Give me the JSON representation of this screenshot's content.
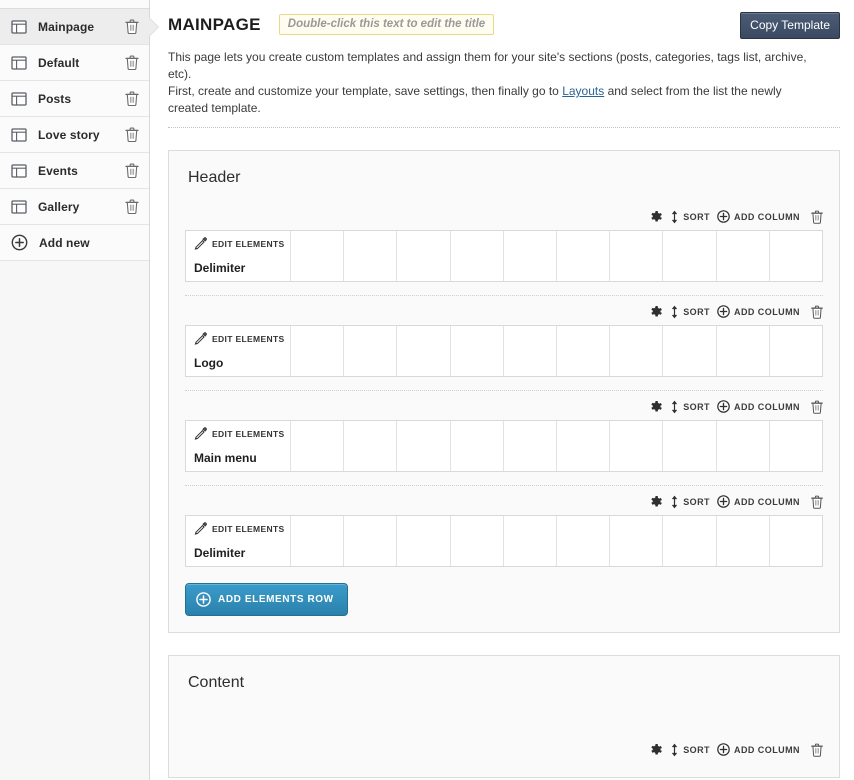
{
  "sidebar": {
    "items": [
      {
        "label": "Mainpage",
        "icon": "template-icon",
        "active": true,
        "delete_icon": "trash-icon"
      },
      {
        "label": "Default",
        "icon": "template-icon",
        "active": false,
        "delete_icon": "trash-icon"
      },
      {
        "label": "Posts",
        "icon": "template-icon",
        "active": false,
        "delete_icon": "trash-icon"
      },
      {
        "label": "Love story",
        "icon": "template-icon",
        "active": false,
        "delete_icon": "trash-icon"
      },
      {
        "label": "Events",
        "icon": "template-icon",
        "active": false,
        "delete_icon": "trash-icon"
      },
      {
        "label": "Gallery",
        "icon": "template-icon",
        "active": false,
        "delete_icon": "trash-icon"
      }
    ],
    "add_new": {
      "label": "Add new",
      "icon": "plus-circle-icon"
    }
  },
  "header": {
    "title": "MAINPAGE",
    "title_hint": "Double-click this text to edit the title",
    "copy_template_label": "Copy Template",
    "intro_line1": "This page lets you create custom templates and assign them for your site's sections (posts, categories, tags list, archive, etc).",
    "intro_line2_pre": "First, create and customize your template, save settings, then finally go to ",
    "intro_link": "Layouts",
    "intro_line2_post": " and select from the list the newly created template."
  },
  "toolbar": {
    "gear_icon": "gear-icon",
    "sort_icon": "sort-arrows-icon",
    "sort_label": "SORT",
    "add_column_icon": "plus-circle-icon",
    "add_column_label": "ADD COLUMN",
    "delete_icon": "trash-icon"
  },
  "cell": {
    "edit_icon": "pencil-icon",
    "edit_label": "EDIT ELEMENTS"
  },
  "sections": [
    {
      "title": "Header",
      "column_count": 12,
      "wide_cell_span": 2,
      "rows": [
        {
          "element_name": "Delimiter"
        },
        {
          "element_name": "Logo"
        },
        {
          "element_name": "Main menu"
        },
        {
          "element_name": "Delimiter"
        }
      ],
      "add_elements_row": {
        "label": "ADD ELEMENTS ROW",
        "icon": "plus-circle-icon"
      }
    },
    {
      "title": "Content",
      "column_count": 12,
      "wide_cell_span": 2,
      "rows": [],
      "add_elements_row": null
    }
  ],
  "colors": {
    "accent_blue": "#2b81ad",
    "copy_button": "#44526b",
    "hint_border": "#e6d98a",
    "hint_bg": "#fffdf0",
    "link": "#2a6496",
    "sidebar_bg": "#f7f7f7",
    "active_item_bg": "#ededed",
    "panel_bg": "#fafafa"
  }
}
